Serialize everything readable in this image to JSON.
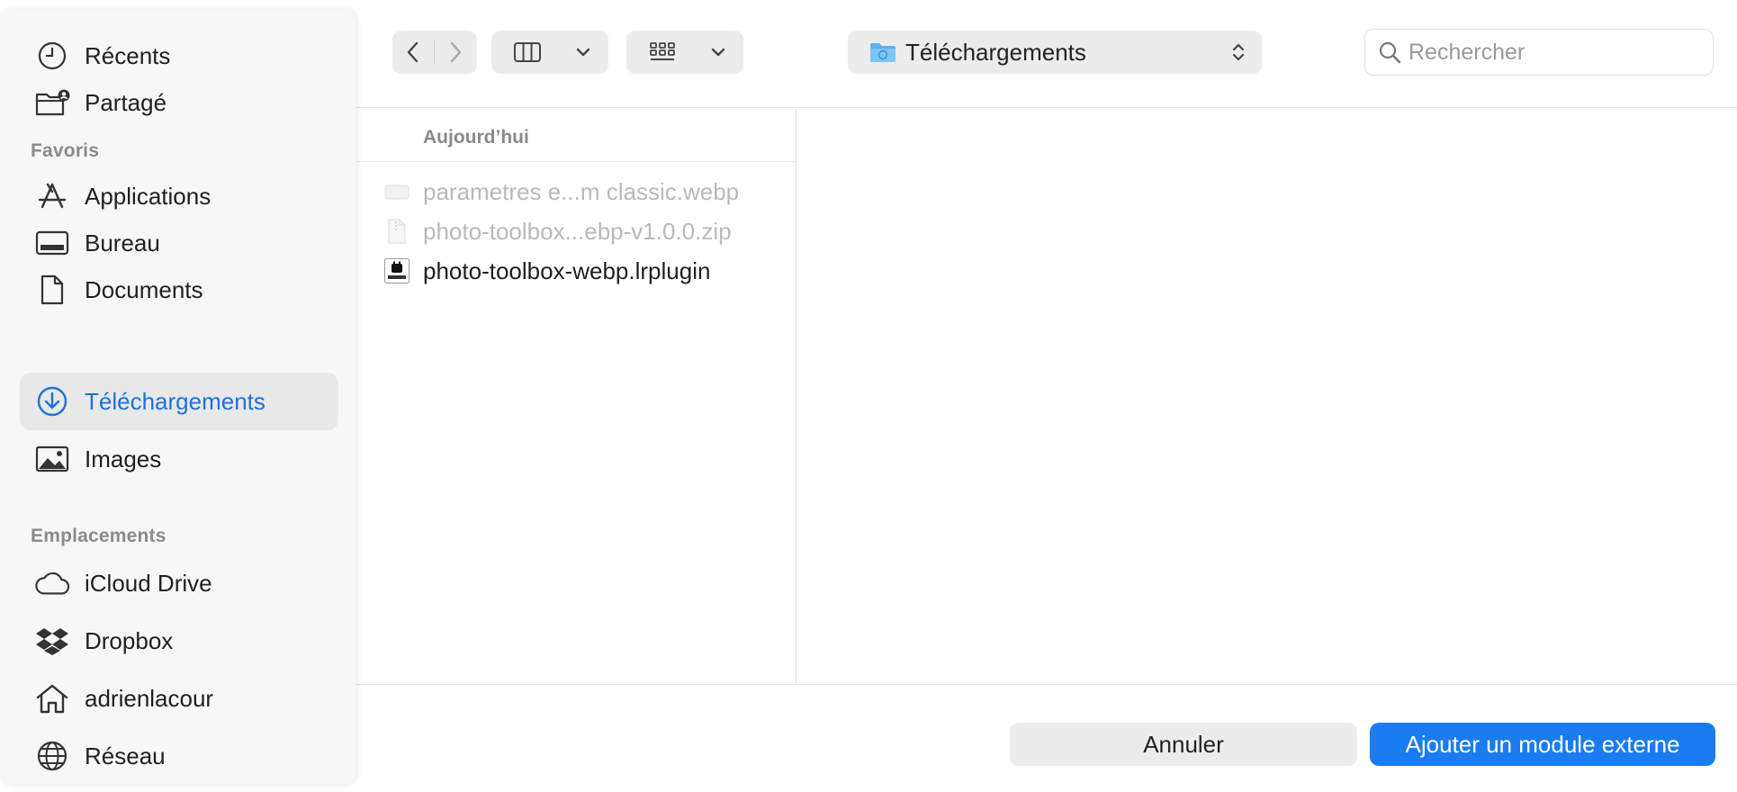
{
  "sidebar": {
    "top_items": [
      {
        "label": "Récents",
        "icon": "clock-icon"
      },
      {
        "label": "Partagé",
        "icon": "shared-folder-icon"
      }
    ],
    "favorites_title": "Favoris",
    "favorites": [
      {
        "label": "Applications",
        "icon": "applications-icon"
      },
      {
        "label": "Bureau",
        "icon": "desktop-icon"
      },
      {
        "label": "Documents",
        "icon": "document-icon"
      },
      {
        "label": "Téléchargements",
        "icon": "download-icon",
        "selected": true
      },
      {
        "label": "Images",
        "icon": "photo-icon"
      }
    ],
    "locations_title": "Emplacements",
    "locations": [
      {
        "label": "iCloud Drive",
        "icon": "cloud-icon"
      },
      {
        "label": "Dropbox",
        "icon": "dropbox-icon"
      },
      {
        "label": "adrienlacour",
        "icon": "home-icon"
      },
      {
        "label": "Réseau",
        "icon": "network-icon"
      }
    ]
  },
  "toolbar": {
    "path_label": "Téléchargements",
    "search_placeholder": "Rechercher"
  },
  "browser": {
    "column_header": "Aujourd’hui",
    "files": [
      {
        "name": "parametres e...m classic.webp",
        "dimmed": true,
        "icon": "image-file-icon"
      },
      {
        "name": "photo-toolbox...ebp-v1.0.0.zip",
        "dimmed": true,
        "icon": "zip-file-icon"
      },
      {
        "name": "photo-toolbox-webp.lrplugin",
        "dimmed": false,
        "icon": "plugin-file-icon"
      }
    ]
  },
  "footer": {
    "cancel_label": "Annuler",
    "confirm_label": "Ajouter un module externe"
  },
  "colors": {
    "accent": "#1a7cf0",
    "selected_text": "#1a73d9",
    "dimmed_text": "#b9b9b9"
  }
}
